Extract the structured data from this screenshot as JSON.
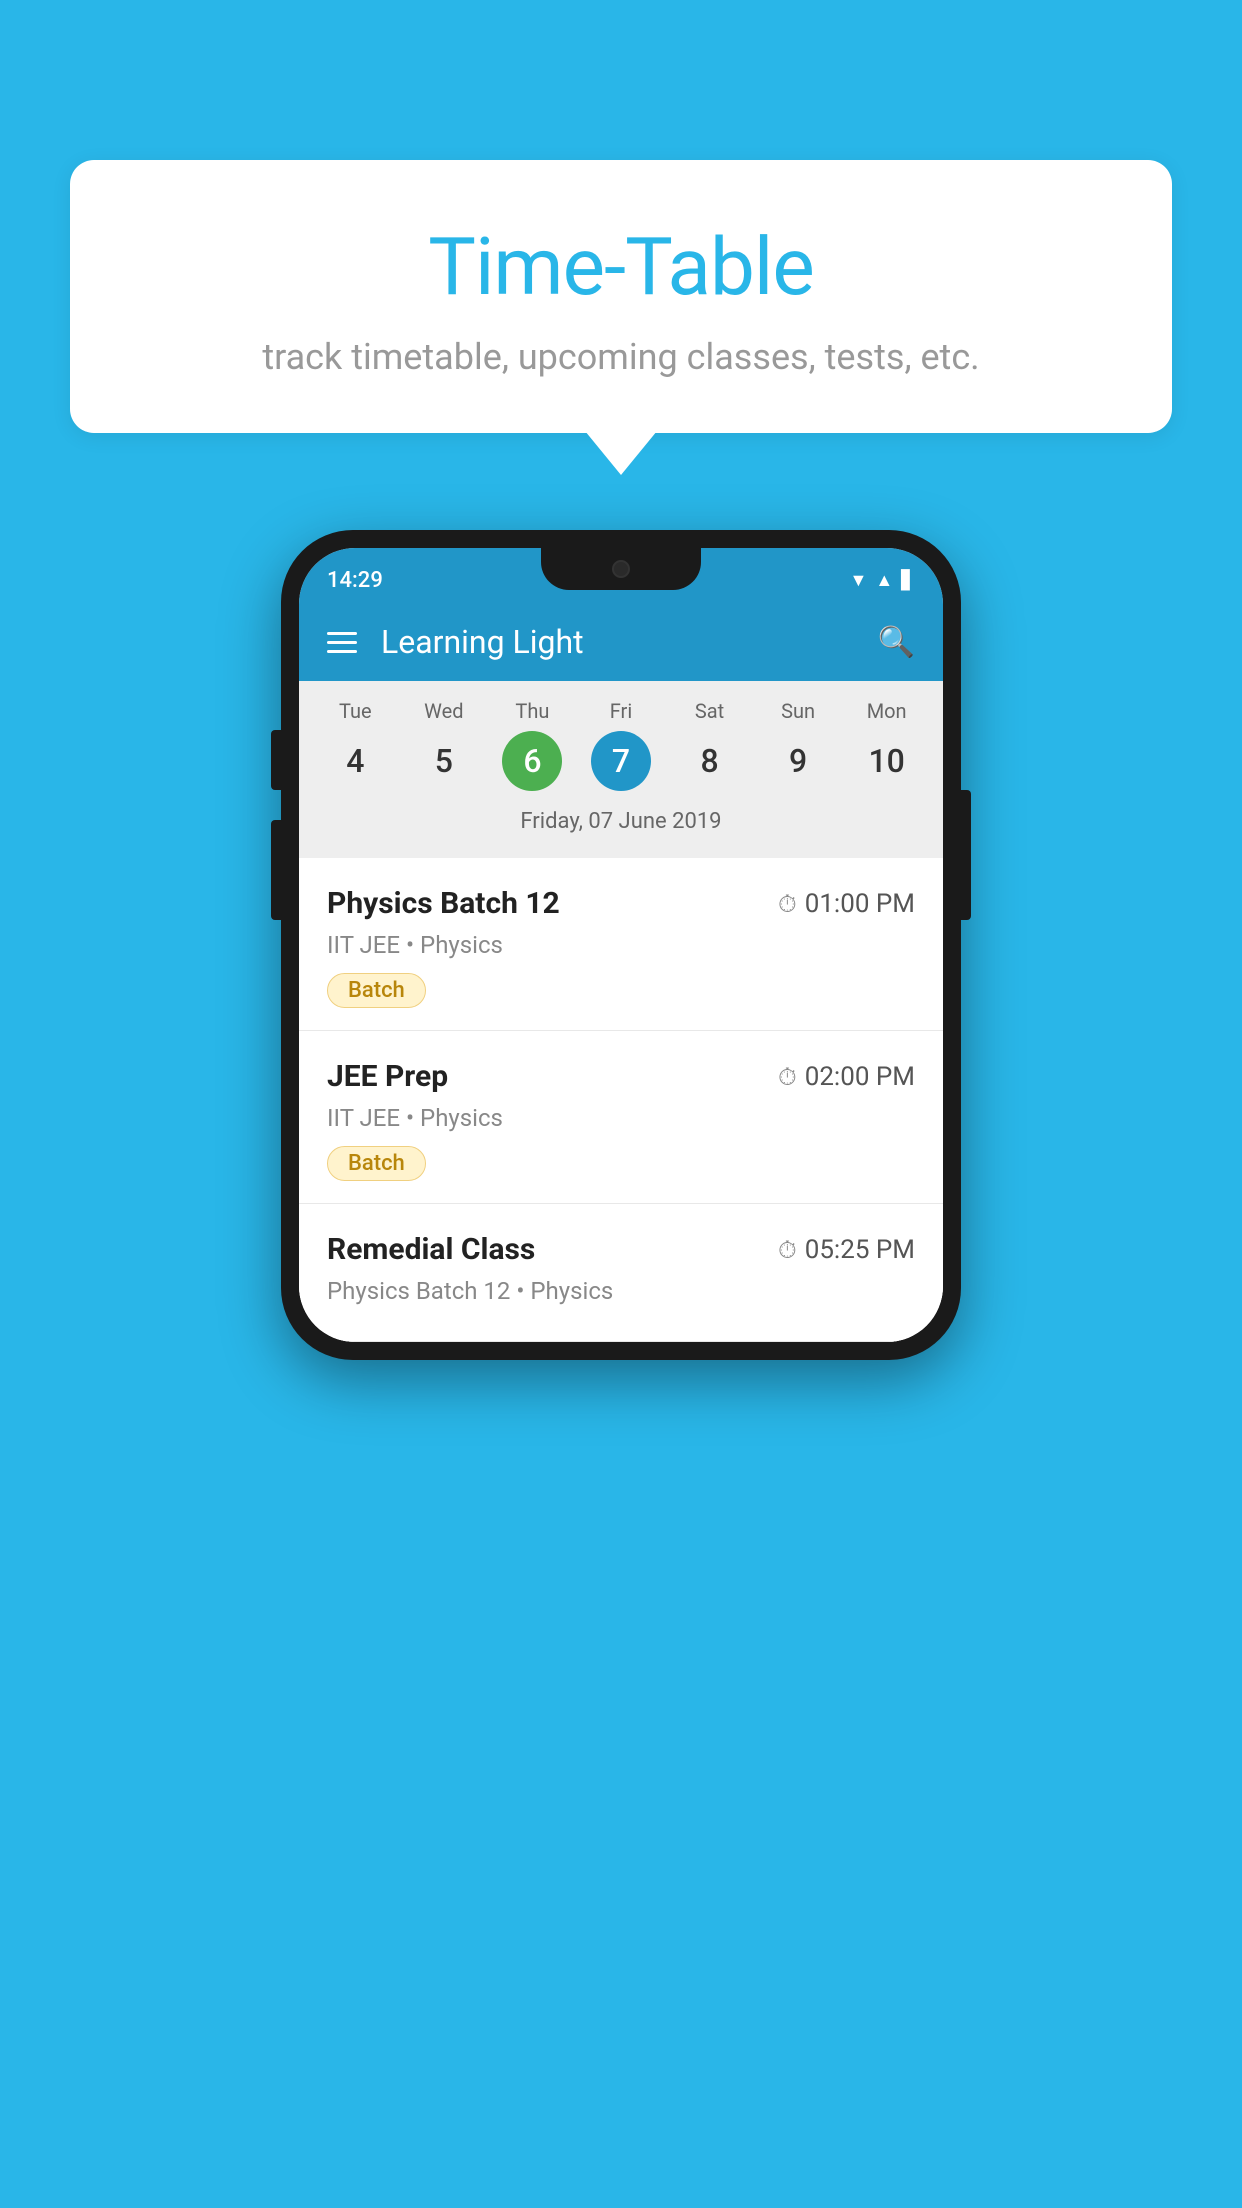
{
  "background": {
    "color": "#29b6e8"
  },
  "bubble": {
    "title": "Time-Table",
    "subtitle": "track timetable, upcoming classes, tests, etc."
  },
  "phone": {
    "status_bar": {
      "time": "14:29"
    },
    "app_bar": {
      "title": "Learning Light"
    },
    "calendar": {
      "days": [
        {
          "name": "Tue",
          "num": "4",
          "state": "normal"
        },
        {
          "name": "Wed",
          "num": "5",
          "state": "normal"
        },
        {
          "name": "Thu",
          "num": "6",
          "state": "today"
        },
        {
          "name": "Fri",
          "num": "7",
          "state": "selected"
        },
        {
          "name": "Sat",
          "num": "8",
          "state": "normal"
        },
        {
          "name": "Sun",
          "num": "9",
          "state": "normal"
        },
        {
          "name": "Mon",
          "num": "10",
          "state": "normal"
        }
      ],
      "date_label": "Friday, 07 June 2019"
    },
    "schedule": [
      {
        "title": "Physics Batch 12",
        "time": "01:00 PM",
        "meta": "IIT JEE • Physics",
        "badge": "Batch"
      },
      {
        "title": "JEE Prep",
        "time": "02:00 PM",
        "meta": "IIT JEE • Physics",
        "badge": "Batch"
      },
      {
        "title": "Remedial Class",
        "time": "05:25 PM",
        "meta": "Physics Batch 12 • Physics",
        "badge": null
      }
    ]
  },
  "icons": {
    "hamburger": "≡",
    "search": "🔍",
    "clock": "🕐"
  }
}
